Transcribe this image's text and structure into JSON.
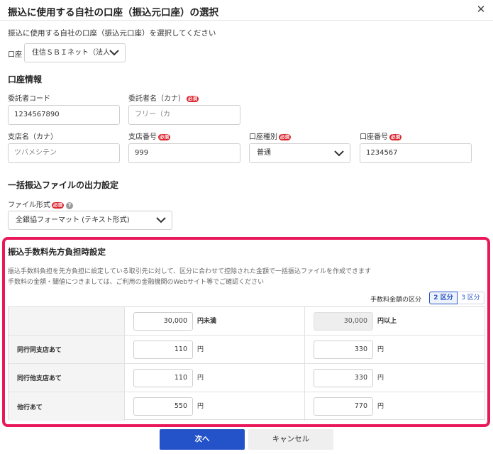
{
  "dialog": {
    "title": "振込に使用する自社の口座（振込元口座）の選択",
    "close_icon": "close-icon"
  },
  "intro": "振込に使用する自社の口座（振込元口座）を選択してください",
  "account": {
    "label": "口座",
    "selected": "住信ＳＢＩネット（法人"
  },
  "account_info": {
    "heading": "口座情報",
    "required_badge": "必須",
    "fields": {
      "consignor_code": {
        "label": "委託者コード",
        "value": "1234567890"
      },
      "consignor_name_kana": {
        "label": "委託者名（カナ）",
        "value": "フリー（カ"
      },
      "branch_name_kana": {
        "label": "支店名（カナ）",
        "value": "ツバメシテン"
      },
      "branch_number": {
        "label": "支店番号",
        "value": "999"
      },
      "account_type": {
        "label": "口座種別",
        "value": "普通"
      },
      "account_number": {
        "label": "口座番号",
        "value": "1234567"
      }
    }
  },
  "output_settings": {
    "heading": "一括振込ファイルの出力設定",
    "file_format_label": "ファイル形式",
    "help_icon": "?",
    "file_format_value": "全銀協フォーマット (テキスト形式)"
  },
  "fee_settings": {
    "heading": "振込手数料先方負担時設定",
    "desc1": "振込手数料負担を先方負担に設定している取引先に対して、区分に合わせて控除された金額で一括振込ファイルを作成できます",
    "desc2": "手数料の金額・閾値につきましては、ご利用の金融機関のWebサイト等でご確認ください",
    "segment_label": "手数料金額の区分",
    "segments": [
      "2 区分",
      "3 区分"
    ],
    "active_segment": "2 区分",
    "threshold": {
      "lower_value": "30,000",
      "lower_unit": "円未満",
      "upper_value": "30,000",
      "upper_unit": "円以上"
    },
    "unit": "円",
    "rows": [
      {
        "label": "同行同支店あて",
        "below": "110",
        "above": "330"
      },
      {
        "label": "同行他支店あて",
        "below": "110",
        "above": "330"
      },
      {
        "label": "他行あて",
        "below": "550",
        "above": "770"
      }
    ]
  },
  "footer": {
    "next_label": "次へ",
    "cancel_label": "キャンセル"
  },
  "colors": {
    "primary": "#2452c8",
    "required": "#d9252e",
    "highlight_border": "#e8185a"
  }
}
